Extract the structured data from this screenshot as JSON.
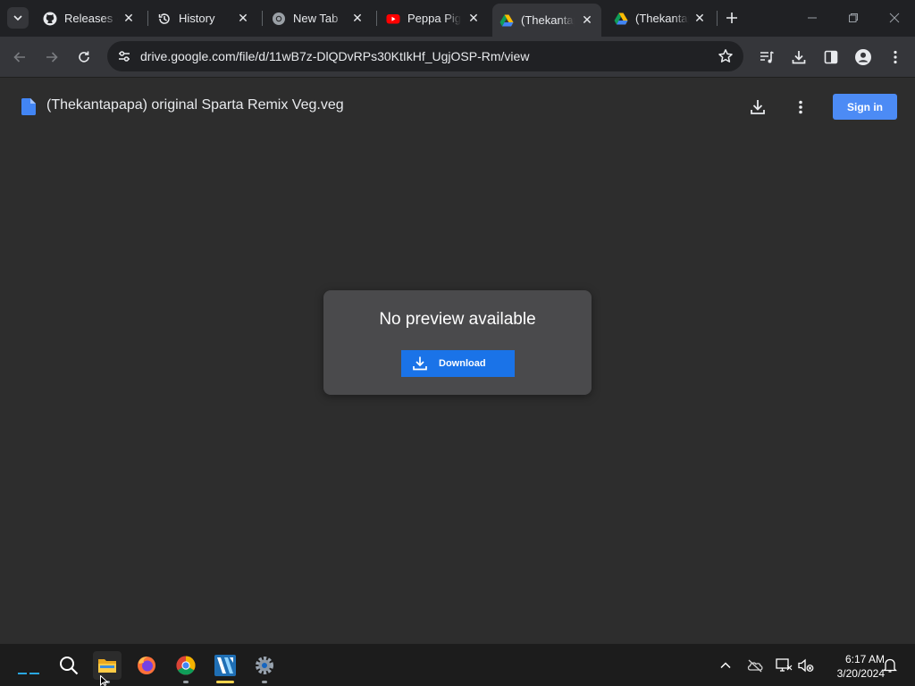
{
  "browser": {
    "tabs": [
      {
        "title": "Releases ·",
        "favicon": "github-icon",
        "active": false
      },
      {
        "title": "History",
        "favicon": "history-icon",
        "active": false
      },
      {
        "title": "New Tab",
        "favicon": "chrome-icon",
        "active": false
      },
      {
        "title": "Peppa Pig",
        "favicon": "youtube-icon",
        "active": false
      },
      {
        "title": "(Thekantap",
        "favicon": "google-drive-icon",
        "active": true
      },
      {
        "title": "(Thekantap",
        "favicon": "google-drive-icon",
        "active": false
      }
    ],
    "url": "drive.google.com/file/d/11wB7z-DlQDvRPs30KtIkHf_UgjOSP-Rm/view"
  },
  "drive": {
    "file_title": "(Thekantapapa) original Sparta Remix Veg.veg",
    "sign_in_label": "Sign in",
    "preview_message": "No preview available",
    "download_label": "Download"
  },
  "taskbar": {
    "time": "6:17 AM",
    "date": "3/20/2024",
    "apps": [
      "start-icon",
      "search-icon",
      "file-explorer-icon",
      "firefox-icon",
      "chrome-icon",
      "video-editor-icon",
      "settings-icon"
    ]
  },
  "colors": {
    "accent_blue": "#1a73e8",
    "sign_in_blue": "#4c8bf5",
    "page_bg": "#2d2d2d",
    "card_bg": "#4a4a4c"
  }
}
